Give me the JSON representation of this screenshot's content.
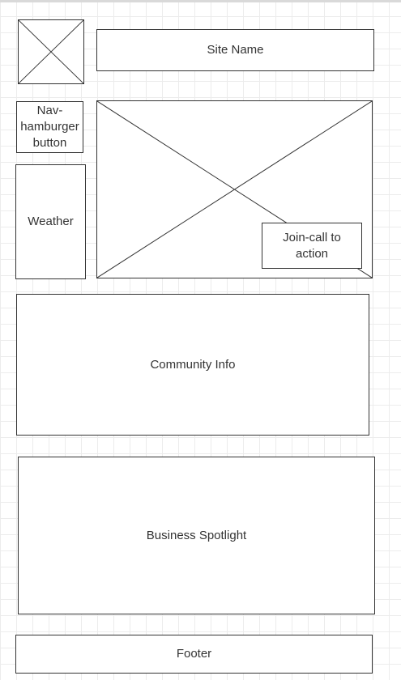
{
  "wireframe": {
    "site_name": "Site Name",
    "nav_button": "Nav-hamburger button",
    "weather": "Weather",
    "cta": "Join-call to action",
    "community": "Community Info",
    "business": "Business Spotlight",
    "footer": "Footer"
  }
}
